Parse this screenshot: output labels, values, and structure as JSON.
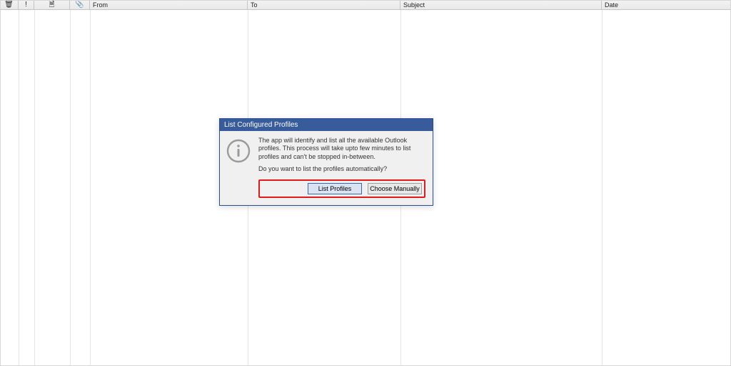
{
  "columns": {
    "delete_icon": "🗑",
    "priority_icon": "!",
    "doc_icon": "🗎",
    "attach_icon": "📎",
    "from": "From",
    "to": "To",
    "subject": "Subject",
    "date": "Date"
  },
  "dialog": {
    "title": "List Configured Profiles",
    "message1": "The app will identify and list all the available Outlook profiles. This process will take upto few minutes to list profiles and can't be stopped in-between.",
    "message2": "Do you want to list the profiles automatically?",
    "btn_list": "List Profiles",
    "btn_choose": "Choose Manually"
  }
}
